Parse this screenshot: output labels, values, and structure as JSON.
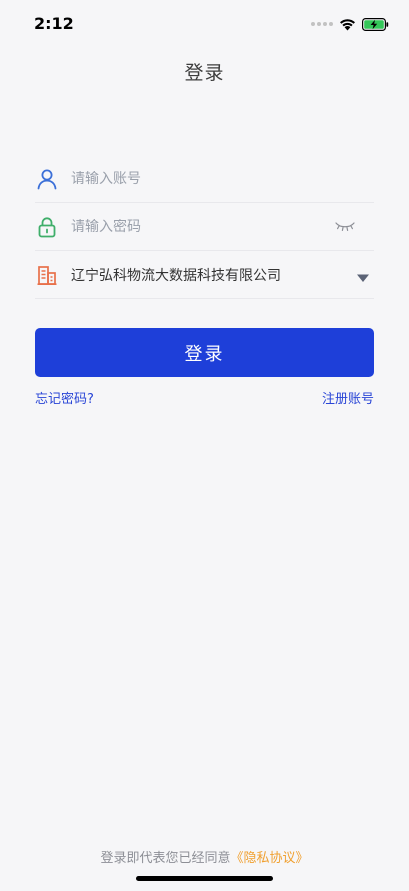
{
  "status_bar": {
    "time": "2:12"
  },
  "header": {
    "title": "登录"
  },
  "form": {
    "account": {
      "placeholder": "请输入账号",
      "value": ""
    },
    "password": {
      "placeholder": "请输入密码",
      "value": ""
    },
    "company": {
      "selected": "辽宁弘科物流大数据科技有限公司"
    }
  },
  "actions": {
    "login_label": "登录",
    "forgot_label": "忘记密码?",
    "register_label": "注册账号"
  },
  "footer": {
    "agreement_prefix": "登录即代表您已经同意",
    "privacy_label": "《隐私协议》"
  },
  "colors": {
    "primary": "#1e3fd9",
    "link": "#2945d6",
    "accent": "#f0a030",
    "user_icon": "#3b6fd8",
    "lock_icon": "#3fae6a",
    "building_icon": "#e8704a"
  },
  "icons": {
    "account": "user-icon",
    "password": "lock-icon",
    "company": "building-icon",
    "toggle": "eye-closed-icon",
    "dropdown": "triangle-down-icon"
  }
}
